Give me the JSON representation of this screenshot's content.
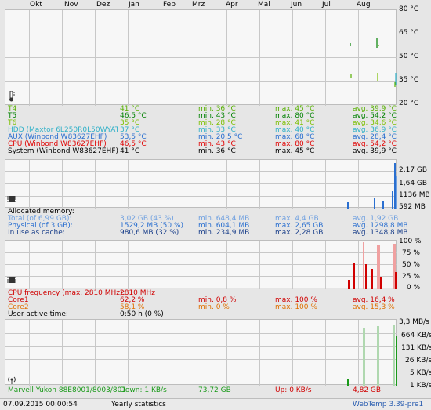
{
  "months": [
    "Okt",
    "Nov",
    "Dez",
    "Jan",
    "Feb",
    "Mrz",
    "Apr",
    "Mai",
    "Jun",
    "Jul",
    "Aug"
  ],
  "temperature": {
    "scale": [
      "80 °C",
      "65 °C",
      "50 °C",
      "35 °C",
      "20 °C"
    ],
    "rows": [
      {
        "label": "T4",
        "value": "41 °C",
        "min": "min. 36 °C",
        "max": "max. 45 °C",
        "avg": "avg. 39,9 °C",
        "color": "#55b000"
      },
      {
        "label": "T5",
        "value": "46,5 °C",
        "min": "min. 43 °C",
        "max": "max. 80 °C",
        "avg": "avg. 54,2 °C",
        "color": "#008000"
      },
      {
        "label": "T6",
        "value": "35 °C",
        "min": "min. 28 °C",
        "max": "max. 41 °C",
        "avg": "avg. 34,6 °C",
        "color": "#7bbf00"
      },
      {
        "label": "HDD (Maxtor 6L250R0L50WYATH",
        "value": "37 °C",
        "min": "min. 33 °C",
        "max": "max. 40 °C",
        "avg": "avg. 36,9 °C",
        "color": "#2fb0c8"
      },
      {
        "label": "AUX (Winbond W83627EHF)",
        "value": "53,5 °C",
        "min": "min. 20,5 °C",
        "max": "max. 68 °C",
        "avg": "avg. 28,4 °C",
        "color": "#2a6fd0"
      },
      {
        "label": "CPU (Winbond W83627EHF)",
        "value": "46,5 °C",
        "min": "min. 43 °C",
        "max": "max. 80 °C",
        "avg": "avg. 54,2 °C",
        "color": "#e00000"
      },
      {
        "label": "System (Winbond W83627EHF)",
        "value": "41 °C",
        "min": "min. 36 °C",
        "max": "max. 45 °C",
        "avg": "avg. 39,9 °C",
        "color": "#000000"
      }
    ]
  },
  "memory": {
    "scale": [
      "2,17 GB",
      "1,64 GB",
      "1136 MB",
      "592 MB"
    ],
    "header": "Allocated memory:",
    "rows": [
      {
        "label": "Total (of 6,99 GB):",
        "value": "3,02 GB (43 %)",
        "min": "min. 648,4 MB",
        "max": "max. 4,4 GB",
        "avg": "avg. 1,92 GB",
        "color": "#6fa0e0"
      },
      {
        "label": "Physical (of 3 GB):",
        "value": "1529,2 MB (50 %)",
        "min": "min. 604,1 MB",
        "max": "max. 2,65 GB",
        "avg": "avg. 1298,8 MB",
        "color": "#2a6fd0"
      },
      {
        "label": "In use as cache:",
        "value": "980,6 MB (32 %)",
        "min": "min. 234,9 MB",
        "max": "max. 2,28 GB",
        "avg": "avg. 1348,8 MB",
        "color": "#1a3f8a"
      }
    ]
  },
  "cpu": {
    "scale": [
      "100 %",
      "75 %",
      "50 %",
      "25 %",
      "0 %"
    ],
    "header_label": "CPU frequency (max. 2810 MHz):",
    "header_value": "2810 MHz",
    "rows": [
      {
        "label": "Core1",
        "value": "62,2 %",
        "min": "min. 0,8 %",
        "max": "max. 100 %",
        "avg": "avg. 16,4 %",
        "color": "#d00000"
      },
      {
        "label": "Core2",
        "value": "58,1 %",
        "min": "min. 0 %",
        "max": "max. 100 %",
        "avg": "avg. 15,3 %",
        "color": "#e07000"
      }
    ],
    "user_active_label": "User active time:",
    "user_active_value": "0:50 h (0 %)"
  },
  "network": {
    "scale": [
      "3,3 MB/s",
      "664 KB/s",
      "131 KB/s",
      "26 KB/s",
      "5 KB/s",
      "1 KB/s"
    ],
    "adapter": "Marvell Yukon 88E8001/8003/801",
    "down": "Down: 1 KB/s",
    "down_total": "73,72 GB",
    "up": "Up: 0 KB/s",
    "up_total": "4,82 GB"
  },
  "status": {
    "datetime": "07.09.2015 00:00:54",
    "mode": "Yearly statistics",
    "app": "WebTemp 3.39-pre1"
  },
  "colors": {
    "down": "#1a9a1a",
    "up": "#d00000",
    "grid": "#c8c8c8"
  }
}
